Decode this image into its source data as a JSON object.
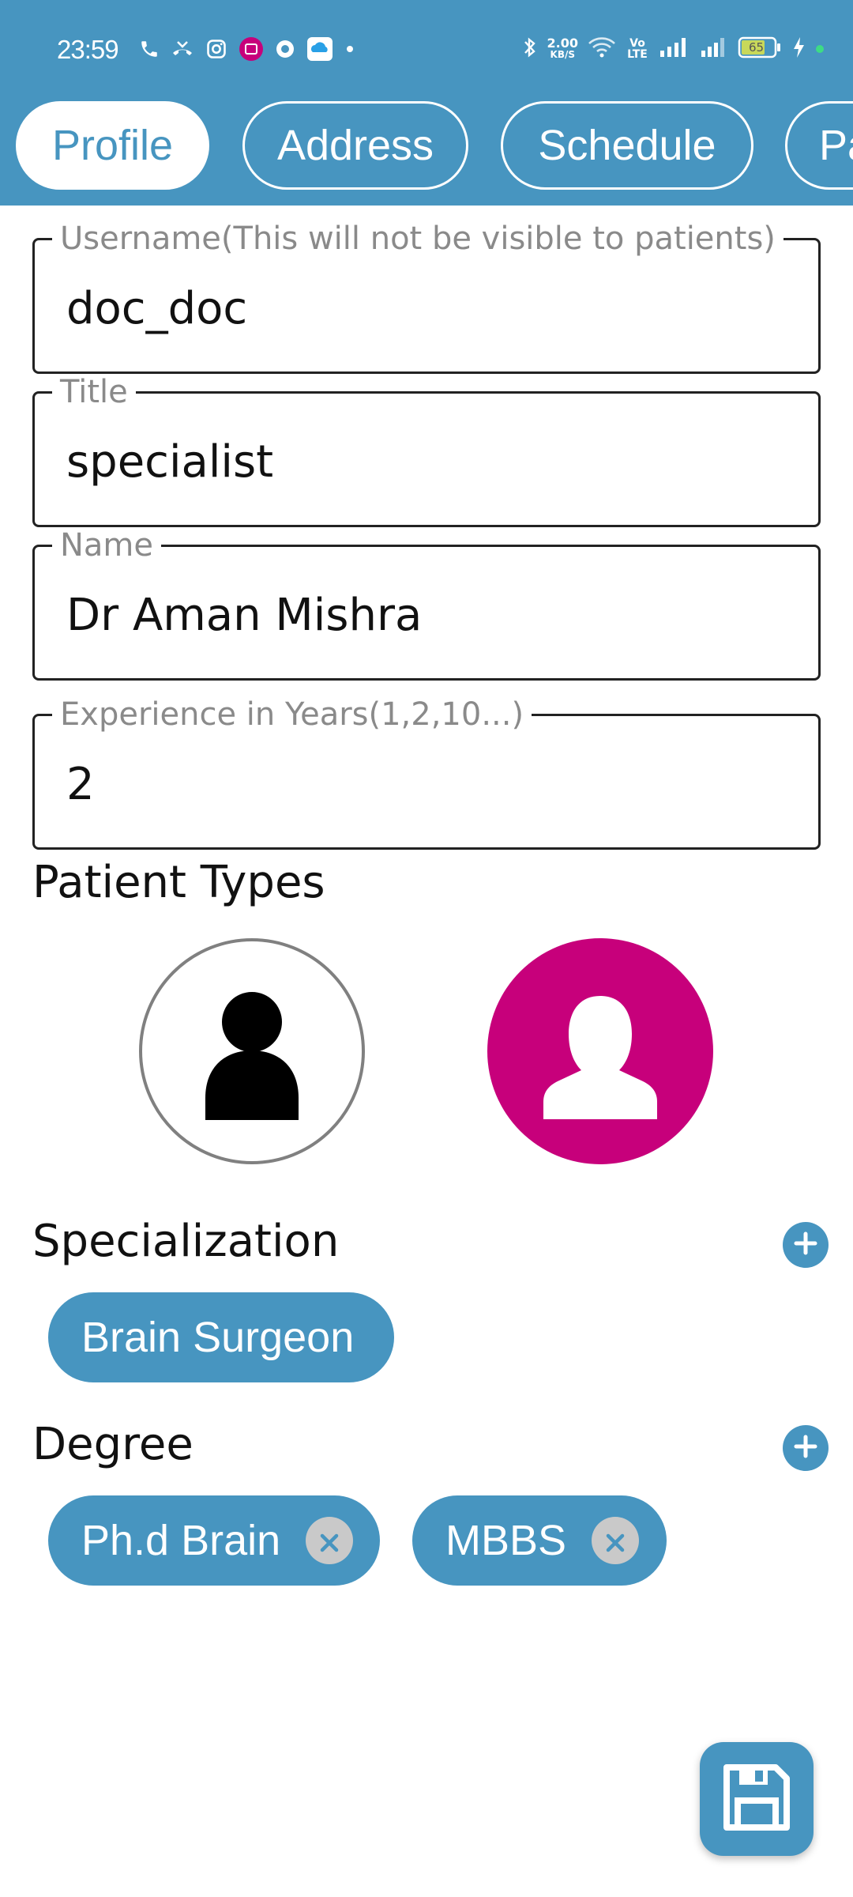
{
  "status_bar": {
    "time": "23:59",
    "net_speed_value": "2.00",
    "net_speed_unit": "KB/S",
    "volte": "Vo LTE",
    "battery": "65"
  },
  "tabs": [
    {
      "label": "Profile",
      "active": true
    },
    {
      "label": "Address",
      "active": false
    },
    {
      "label": "Schedule",
      "active": false
    },
    {
      "label": "Pa",
      "active": false
    }
  ],
  "form": {
    "username": {
      "label": "Username(This will not be visible to patients)",
      "value": "doc_doc"
    },
    "title": {
      "label": "Title",
      "value": "specialist"
    },
    "name": {
      "label": "Name",
      "value": "Dr Aman Mishra"
    },
    "experience": {
      "label": "Experience in Years(1,2,10...)",
      "value": "2"
    }
  },
  "patient_types": {
    "heading": "Patient Types",
    "options": [
      {
        "icon": "male-person-icon",
        "selected": false
      },
      {
        "icon": "female-person-icon",
        "selected": true,
        "color": "#c7007b"
      }
    ]
  },
  "specialization": {
    "heading": "Specialization",
    "chips": [
      "Brain Surgeon"
    ]
  },
  "degree": {
    "heading": "Degree",
    "chips": [
      "Ph.d Brain",
      "MBBS"
    ]
  },
  "colors": {
    "primary": "#4795c0",
    "accent_female": "#c7007b"
  },
  "icons": {
    "add": "plus-circle-icon",
    "remove_chip": "close-circle-icon",
    "save": "floppy-disk-icon"
  }
}
